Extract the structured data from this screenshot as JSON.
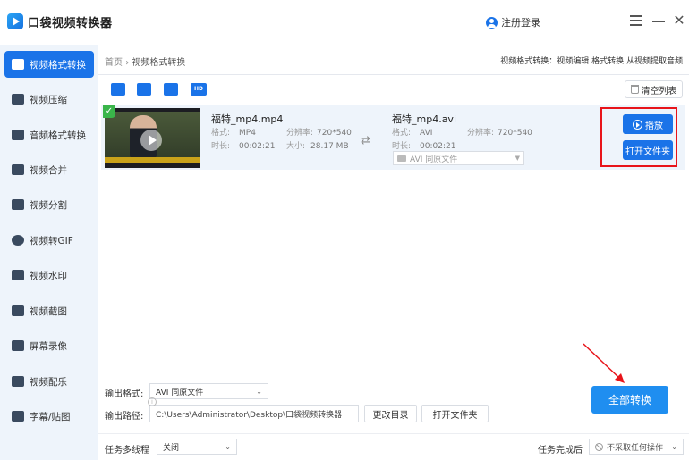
{
  "app": {
    "title": "口袋视频转换器",
    "login": "注册登录"
  },
  "sidebar": {
    "items": [
      {
        "label": "视频格式转换",
        "icon": "video-convert-icon"
      },
      {
        "label": "视频压缩",
        "icon": "video-compress-icon"
      },
      {
        "label": "音频格式转换",
        "icon": "audio-convert-icon"
      },
      {
        "label": "视频合并",
        "icon": "video-merge-icon"
      },
      {
        "label": "视频分割",
        "icon": "video-split-icon"
      },
      {
        "label": "视频转GIF",
        "icon": "gif-icon"
      },
      {
        "label": "视频水印",
        "icon": "watermark-icon"
      },
      {
        "label": "视频截图",
        "icon": "screenshot-icon"
      },
      {
        "label": "屏幕录像",
        "icon": "screen-record-icon"
      },
      {
        "label": "视频配乐",
        "icon": "music-icon"
      },
      {
        "label": "字幕/贴图",
        "icon": "subtitle-icon"
      }
    ]
  },
  "breadcrumb": {
    "home": "首页",
    "current": "视频格式转换"
  },
  "tagline": "视频格式转换：视频编辑 格式转换 从视频提取音频",
  "toolbar": {
    "hd_label": "HD",
    "clear": "清空列表"
  },
  "file": {
    "source": {
      "name": "福特_mp4.mp4",
      "format_label": "格式:",
      "format": "MP4",
      "res_label": "分辨率:",
      "res": "720*540",
      "duration_label": "时长:",
      "duration": "00:02:21",
      "size_label": "大小:",
      "size": "28.17 MB"
    },
    "target": {
      "name": "福特_mp4.avi",
      "format_label": "格式:",
      "format": "AVI",
      "res_label": "分辨率:",
      "res": "720*540",
      "duration_label": "时长:",
      "duration": "00:02:21",
      "select": "AVI  同原文件"
    },
    "play": "播放",
    "open_folder": "打开文件夹"
  },
  "bottom": {
    "output_format_label": "输出格式:",
    "output_format": "AVI  同原文件",
    "output_path_label": "输出路径:",
    "output_path": "C:\\Users\\Administrator\\Desktop\\口袋视频转换器",
    "change_dir": "更改目录",
    "open_folder": "打开文件夹",
    "convert_all": "全部转换",
    "multithread_label": "任务多线程",
    "multithread": "关闭",
    "on_complete_label": "任务完成后",
    "on_complete": "不采取任何操作"
  },
  "colors": {
    "accent": "#1a73e8",
    "highlight": "#e8141a",
    "sidebar_bg": "#eef4fb"
  }
}
